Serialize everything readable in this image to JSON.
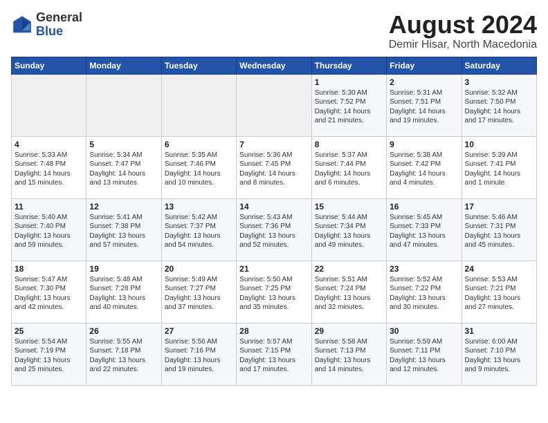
{
  "header": {
    "logo_general": "General",
    "logo_blue": "Blue",
    "month_year": "August 2024",
    "location": "Demir Hisar, North Macedonia"
  },
  "days_of_week": [
    "Sunday",
    "Monday",
    "Tuesday",
    "Wednesday",
    "Thursday",
    "Friday",
    "Saturday"
  ],
  "weeks": [
    [
      {
        "day": "",
        "content": ""
      },
      {
        "day": "",
        "content": ""
      },
      {
        "day": "",
        "content": ""
      },
      {
        "day": "",
        "content": ""
      },
      {
        "day": "1",
        "content": "Sunrise: 5:30 AM\nSunset: 7:52 PM\nDaylight: 14 hours\nand 21 minutes."
      },
      {
        "day": "2",
        "content": "Sunrise: 5:31 AM\nSunset: 7:51 PM\nDaylight: 14 hours\nand 19 minutes."
      },
      {
        "day": "3",
        "content": "Sunrise: 5:32 AM\nSunset: 7:50 PM\nDaylight: 14 hours\nand 17 minutes."
      }
    ],
    [
      {
        "day": "4",
        "content": "Sunrise: 5:33 AM\nSunset: 7:48 PM\nDaylight: 14 hours\nand 15 minutes."
      },
      {
        "day": "5",
        "content": "Sunrise: 5:34 AM\nSunset: 7:47 PM\nDaylight: 14 hours\nand 13 minutes."
      },
      {
        "day": "6",
        "content": "Sunrise: 5:35 AM\nSunset: 7:46 PM\nDaylight: 14 hours\nand 10 minutes."
      },
      {
        "day": "7",
        "content": "Sunrise: 5:36 AM\nSunset: 7:45 PM\nDaylight: 14 hours\nand 8 minutes."
      },
      {
        "day": "8",
        "content": "Sunrise: 5:37 AM\nSunset: 7:44 PM\nDaylight: 14 hours\nand 6 minutes."
      },
      {
        "day": "9",
        "content": "Sunrise: 5:38 AM\nSunset: 7:42 PM\nDaylight: 14 hours\nand 4 minutes."
      },
      {
        "day": "10",
        "content": "Sunrise: 5:39 AM\nSunset: 7:41 PM\nDaylight: 14 hours\nand 1 minute."
      }
    ],
    [
      {
        "day": "11",
        "content": "Sunrise: 5:40 AM\nSunset: 7:40 PM\nDaylight: 13 hours\nand 59 minutes."
      },
      {
        "day": "12",
        "content": "Sunrise: 5:41 AM\nSunset: 7:38 PM\nDaylight: 13 hours\nand 57 minutes."
      },
      {
        "day": "13",
        "content": "Sunrise: 5:42 AM\nSunset: 7:37 PM\nDaylight: 13 hours\nand 54 minutes."
      },
      {
        "day": "14",
        "content": "Sunrise: 5:43 AM\nSunset: 7:36 PM\nDaylight: 13 hours\nand 52 minutes."
      },
      {
        "day": "15",
        "content": "Sunrise: 5:44 AM\nSunset: 7:34 PM\nDaylight: 13 hours\nand 49 minutes."
      },
      {
        "day": "16",
        "content": "Sunrise: 5:45 AM\nSunset: 7:33 PM\nDaylight: 13 hours\nand 47 minutes."
      },
      {
        "day": "17",
        "content": "Sunrise: 5:46 AM\nSunset: 7:31 PM\nDaylight: 13 hours\nand 45 minutes."
      }
    ],
    [
      {
        "day": "18",
        "content": "Sunrise: 5:47 AM\nSunset: 7:30 PM\nDaylight: 13 hours\nand 42 minutes."
      },
      {
        "day": "19",
        "content": "Sunrise: 5:48 AM\nSunset: 7:28 PM\nDaylight: 13 hours\nand 40 minutes."
      },
      {
        "day": "20",
        "content": "Sunrise: 5:49 AM\nSunset: 7:27 PM\nDaylight: 13 hours\nand 37 minutes."
      },
      {
        "day": "21",
        "content": "Sunrise: 5:50 AM\nSunset: 7:25 PM\nDaylight: 13 hours\nand 35 minutes."
      },
      {
        "day": "22",
        "content": "Sunrise: 5:51 AM\nSunset: 7:24 PM\nDaylight: 13 hours\nand 32 minutes."
      },
      {
        "day": "23",
        "content": "Sunrise: 5:52 AM\nSunset: 7:22 PM\nDaylight: 13 hours\nand 30 minutes."
      },
      {
        "day": "24",
        "content": "Sunrise: 5:53 AM\nSunset: 7:21 PM\nDaylight: 13 hours\nand 27 minutes."
      }
    ],
    [
      {
        "day": "25",
        "content": "Sunrise: 5:54 AM\nSunset: 7:19 PM\nDaylight: 13 hours\nand 25 minutes."
      },
      {
        "day": "26",
        "content": "Sunrise: 5:55 AM\nSunset: 7:18 PM\nDaylight: 13 hours\nand 22 minutes."
      },
      {
        "day": "27",
        "content": "Sunrise: 5:56 AM\nSunset: 7:16 PM\nDaylight: 13 hours\nand 19 minutes."
      },
      {
        "day": "28",
        "content": "Sunrise: 5:57 AM\nSunset: 7:15 PM\nDaylight: 13 hours\nand 17 minutes."
      },
      {
        "day": "29",
        "content": "Sunrise: 5:58 AM\nSunset: 7:13 PM\nDaylight: 13 hours\nand 14 minutes."
      },
      {
        "day": "30",
        "content": "Sunrise: 5:59 AM\nSunset: 7:11 PM\nDaylight: 13 hours\nand 12 minutes."
      },
      {
        "day": "31",
        "content": "Sunrise: 6:00 AM\nSunset: 7:10 PM\nDaylight: 13 hours\nand 9 minutes."
      }
    ]
  ]
}
